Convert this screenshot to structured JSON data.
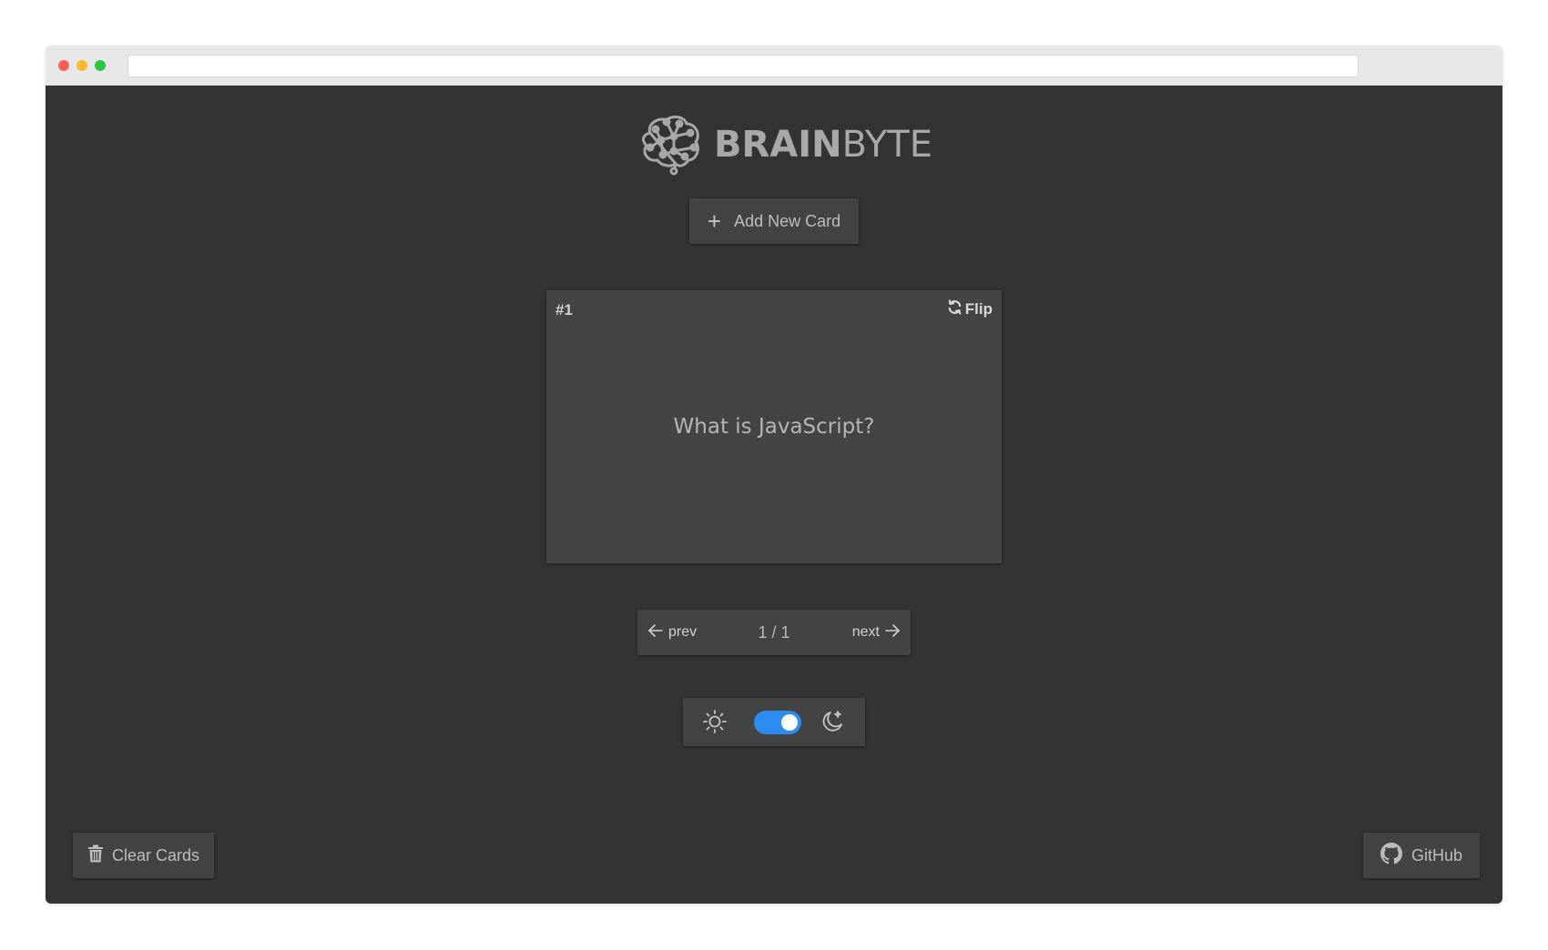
{
  "logo": {
    "bold": "BRAIN",
    "light": "BYTE"
  },
  "toolbar": {
    "add_label": "Add New Card"
  },
  "card": {
    "number": "#1",
    "flip_label": "Flip",
    "question": "What is JavaScript?"
  },
  "pager": {
    "prev_label": "prev",
    "next_label": "next",
    "count": "1 / 1"
  },
  "theme": {
    "dark_mode_enabled": true,
    "toggle_color": "#2d8cf0"
  },
  "footer": {
    "clear_label": "Clear Cards",
    "github_label": "GitHub"
  },
  "icons": {
    "logo": "brain-network-icon",
    "add": "plus-icon",
    "flip": "refresh-icon",
    "prev": "arrow-left-icon",
    "next": "arrow-right-icon",
    "light": "sun-icon",
    "dark": "moon-icon",
    "clear": "trash-icon",
    "github": "github-icon"
  }
}
